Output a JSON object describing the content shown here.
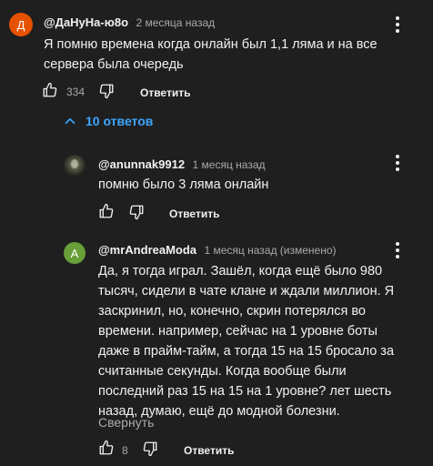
{
  "comments": [
    {
      "avatar_letter": "Д",
      "avatar_color": "#e65100",
      "author": "@ДаНуНа-ю8о",
      "time": "2 месяца назад",
      "text": "Я помню времена когда онлайн был 1,1 ляма и на все сервера была очередь",
      "likes": "334",
      "reply_label": "Ответить"
    }
  ],
  "replies_toggle": {
    "label": "10 ответов",
    "icon": "chevron-up-icon"
  },
  "replies": [
    {
      "avatar_icon": "profile-photo",
      "author": "@anunnak9912",
      "time": "1 месяц назад",
      "text": "помню было 3 ляма онлайн",
      "likes": "",
      "reply_label": "Ответить"
    },
    {
      "avatar_letter": "A",
      "avatar_color": "#689f38",
      "author": "@mrAndreaModa",
      "time": "1 месяц назад (изменено)",
      "text": "Да, я тогда играл. Зашёл, когда ещё было 980 тысяч, сидели в чате клане и ждали миллион. Я заскринил, но, конечно, скрин потерялся во времени. например, сейчас на 1 уровне боты даже в прайм-тайм, а тогда 15 на 15 бросало за считанные секунды. Когда вообще были последний раз 15 на 15 на 1 уровне? лет шесть назад, думаю, ещё до модной болезни.",
      "collapse_label": "Свернуть",
      "likes": "8",
      "reply_label": "Ответить"
    }
  ]
}
